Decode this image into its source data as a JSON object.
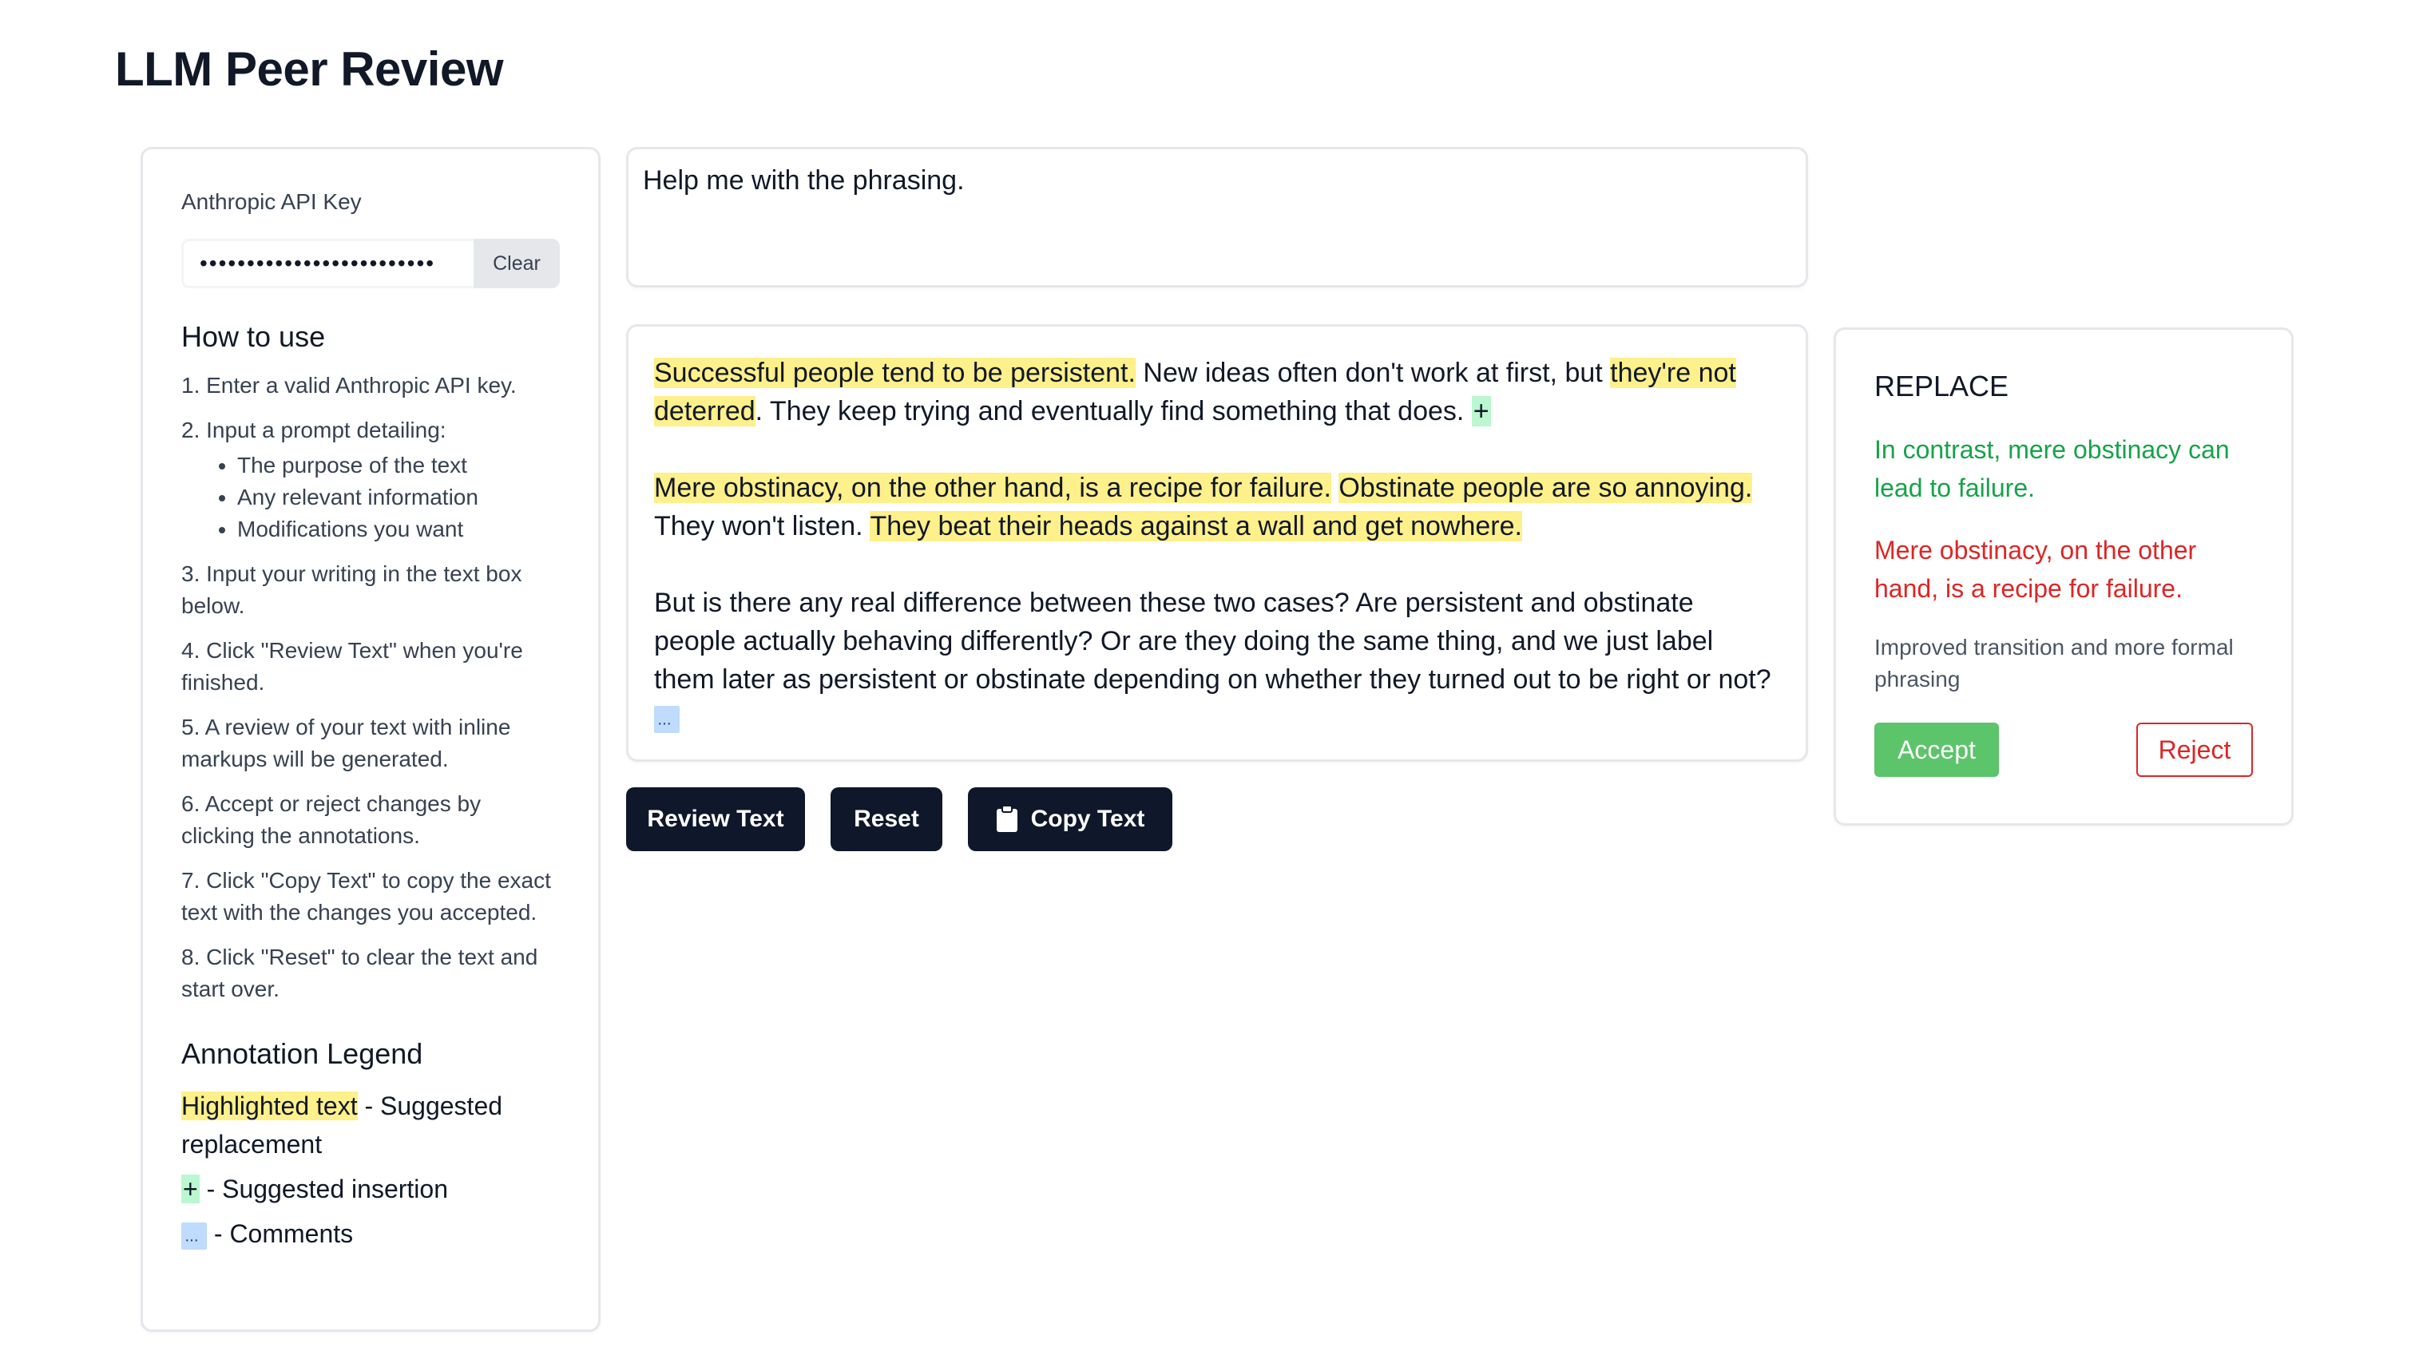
{
  "app": {
    "title": "LLM Peer Review"
  },
  "sidebar": {
    "api_label": "Anthropic API Key",
    "api_value": "•••••••••••••••••••••••••",
    "clear_label": "Clear",
    "how_to_heading": "How to use",
    "steps": [
      "1. Enter a valid Anthropic API key.",
      "2. Input a prompt detailing:",
      "3. Input your writing in the text box below.",
      "4. Click \"Review Text\" when you're finished.",
      "5. A review of your text with inline markups will be generated.",
      "6. Accept or reject changes by clicking the annotations.",
      "7. Click \"Copy Text\" to copy the exact text with the changes you accepted.",
      "8. Click \"Reset\" to clear the text and start over."
    ],
    "sub_steps": [
      "The purpose of the text",
      "Any relevant information",
      "Modifications you want"
    ],
    "legend_heading": "Annotation Legend",
    "legend": {
      "highlight_sample": "Highlighted text",
      "highlight_desc": " - Suggested replacement",
      "insert_sample": "+",
      "insert_desc": " - Suggested insertion",
      "comment_desc": " - Comments"
    }
  },
  "prompt": {
    "value": "Help me with the phrasing."
  },
  "document": {
    "p1": {
      "s1": "Successful people tend to be persistent.",
      "s2": " New ideas often don't work at first, but ",
      "s3": "they're not deterred",
      "s4": ". They keep trying and eventually find something that does. ",
      "insert": "+"
    },
    "p2": {
      "s1": "Mere obstinacy, on the other hand, is a recipe for failure.",
      "s2": " ",
      "s3": "Obstinate people are so annoying.",
      "s4": " They won't listen. ",
      "s5": "They beat their heads against a wall and get nowhere."
    },
    "p3": {
      "s1": "But is there any real difference between these two cases? Are persistent and obstinate people actually behaving differently? Or are they doing the same thing, and we just label them later as persistent or obstinate depending on whether they turned out to be right or not? "
    }
  },
  "buttons": {
    "review": "Review Text",
    "reset": "Reset",
    "copy": "Copy Text"
  },
  "annotation": {
    "type": "REPLACE",
    "suggestion": "In contrast, mere obstinacy can lead to failure.",
    "original": "Mere obstinacy, on the other hand, is a recipe for failure.",
    "reason": "Improved transition and more formal phrasing",
    "accept": "Accept",
    "reject": "Reject"
  },
  "colors": {
    "highlight": "#fef08a",
    "insertion": "#bbf7d0",
    "comment": "#bfdbfe",
    "button_dark": "#0f172a",
    "accept": "#5cc46a",
    "reject": "#dc2626"
  },
  "icons": {
    "copy": "clipboard-icon",
    "comment": "comment-icon"
  }
}
